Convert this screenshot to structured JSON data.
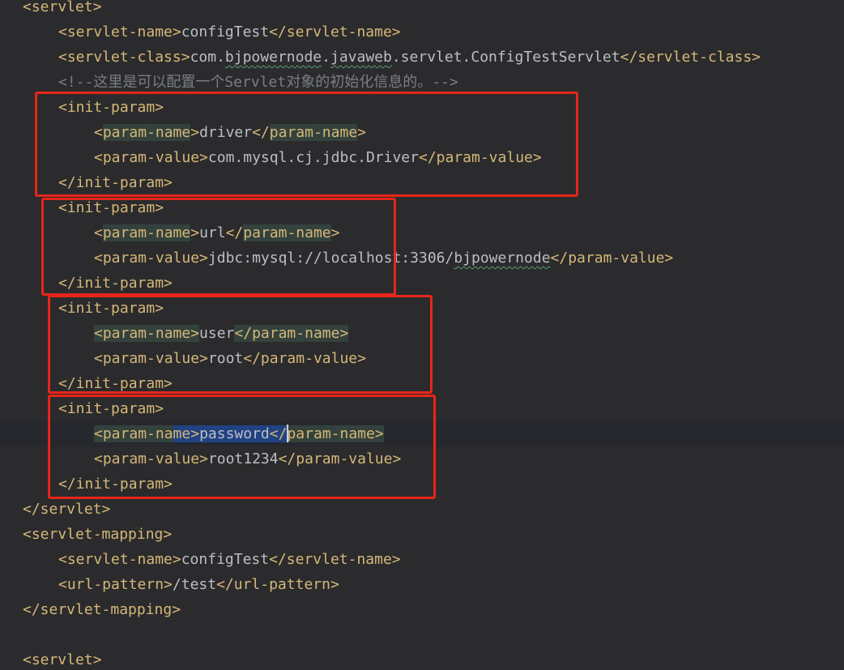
{
  "editor": {
    "lines": [
      {
        "id": "l01",
        "open": "<servlet>"
      },
      {
        "id": "l02",
        "tag_open": "<servlet-name>",
        "text": "configTest",
        "tag_close": "</servlet-name>"
      },
      {
        "id": "l03",
        "tag_open": "<servlet-class>",
        "text_a": "com.",
        "text_sq1": "bjpowernode",
        "text_b": ".",
        "text_sq2": "javaweb",
        "text_c": ".servlet.ConfigTestServlet",
        "tag_close": "</servlet-class>"
      },
      {
        "id": "l04",
        "comment": "<!--这里是可以配置一个Servlet对象的初始化信息的。-->"
      },
      {
        "id": "l05",
        "open": "<init-param>"
      },
      {
        "id": "l06",
        "lt": "<",
        "tag_name": "param-name",
        "gt": ">",
        "text": "driver",
        "close_lt": "</",
        "close_name": "param-name",
        "close_gt": ">"
      },
      {
        "id": "l07",
        "tag_open": "<param-value>",
        "text": "com.mysql.cj.jdbc.Driver",
        "tag_close": "</param-value>"
      },
      {
        "id": "l08",
        "close": "</init-param>"
      },
      {
        "id": "l09",
        "open": "<init-param>"
      },
      {
        "id": "l10",
        "lt": "<",
        "tag_name": "param-name",
        "gt": ">",
        "text": "url",
        "close_lt": "</",
        "close_name": "param-name",
        "close_gt": ">"
      },
      {
        "id": "l11",
        "tag_open": "<param-value>",
        "text_a": "jdbc:mysql://localhost:3306/",
        "text_sq": "bjpowernode",
        "tag_close": "</param-value>"
      },
      {
        "id": "l12",
        "close": "</init-param>"
      },
      {
        "id": "l13",
        "open": "<init-param>"
      },
      {
        "id": "l14",
        "tag_open": "<param-name>",
        "text": "user",
        "tag_close": "</param-name>"
      },
      {
        "id": "l15",
        "tag_open": "<param-value>",
        "text": "root",
        "tag_close": "</param-value>"
      },
      {
        "id": "l16",
        "close": "</init-param>"
      },
      {
        "id": "l17",
        "open": "<init-param>"
      },
      {
        "id": "l18",
        "lt": "<",
        "tag_name_a": "param-na",
        "tag_name_b": "me",
        "gt": ">",
        "text": "password",
        "close_lt": "</",
        "close_name": "param-name",
        "close_gt": ">"
      },
      {
        "id": "l19",
        "tag_open": "<param-value>",
        "text": "root1234",
        "tag_close": "</param-value>"
      },
      {
        "id": "l20",
        "close": "</init-param>"
      },
      {
        "id": "l21",
        "close": "</servlet>"
      },
      {
        "id": "l22",
        "open": "<servlet-mapping>"
      },
      {
        "id": "l23",
        "tag_open": "<servlet-name>",
        "text": "configTest",
        "tag_close": "</servlet-name>"
      },
      {
        "id": "l24",
        "tag_open": "<url-pattern>",
        "text": "/test",
        "tag_close": "</url-pattern>"
      },
      {
        "id": "l25",
        "close": "</servlet-mapping>"
      },
      {
        "id": "l26",
        "open": "<servlet>"
      }
    ]
  },
  "colors": {
    "background": "#2b2b2d",
    "tag": "#d5b778",
    "text": "#bcbec4",
    "comment": "#7a7e85",
    "annotation_box": "#e8251a",
    "selection": "#214283",
    "tag_match_highlight": "#34423d"
  }
}
